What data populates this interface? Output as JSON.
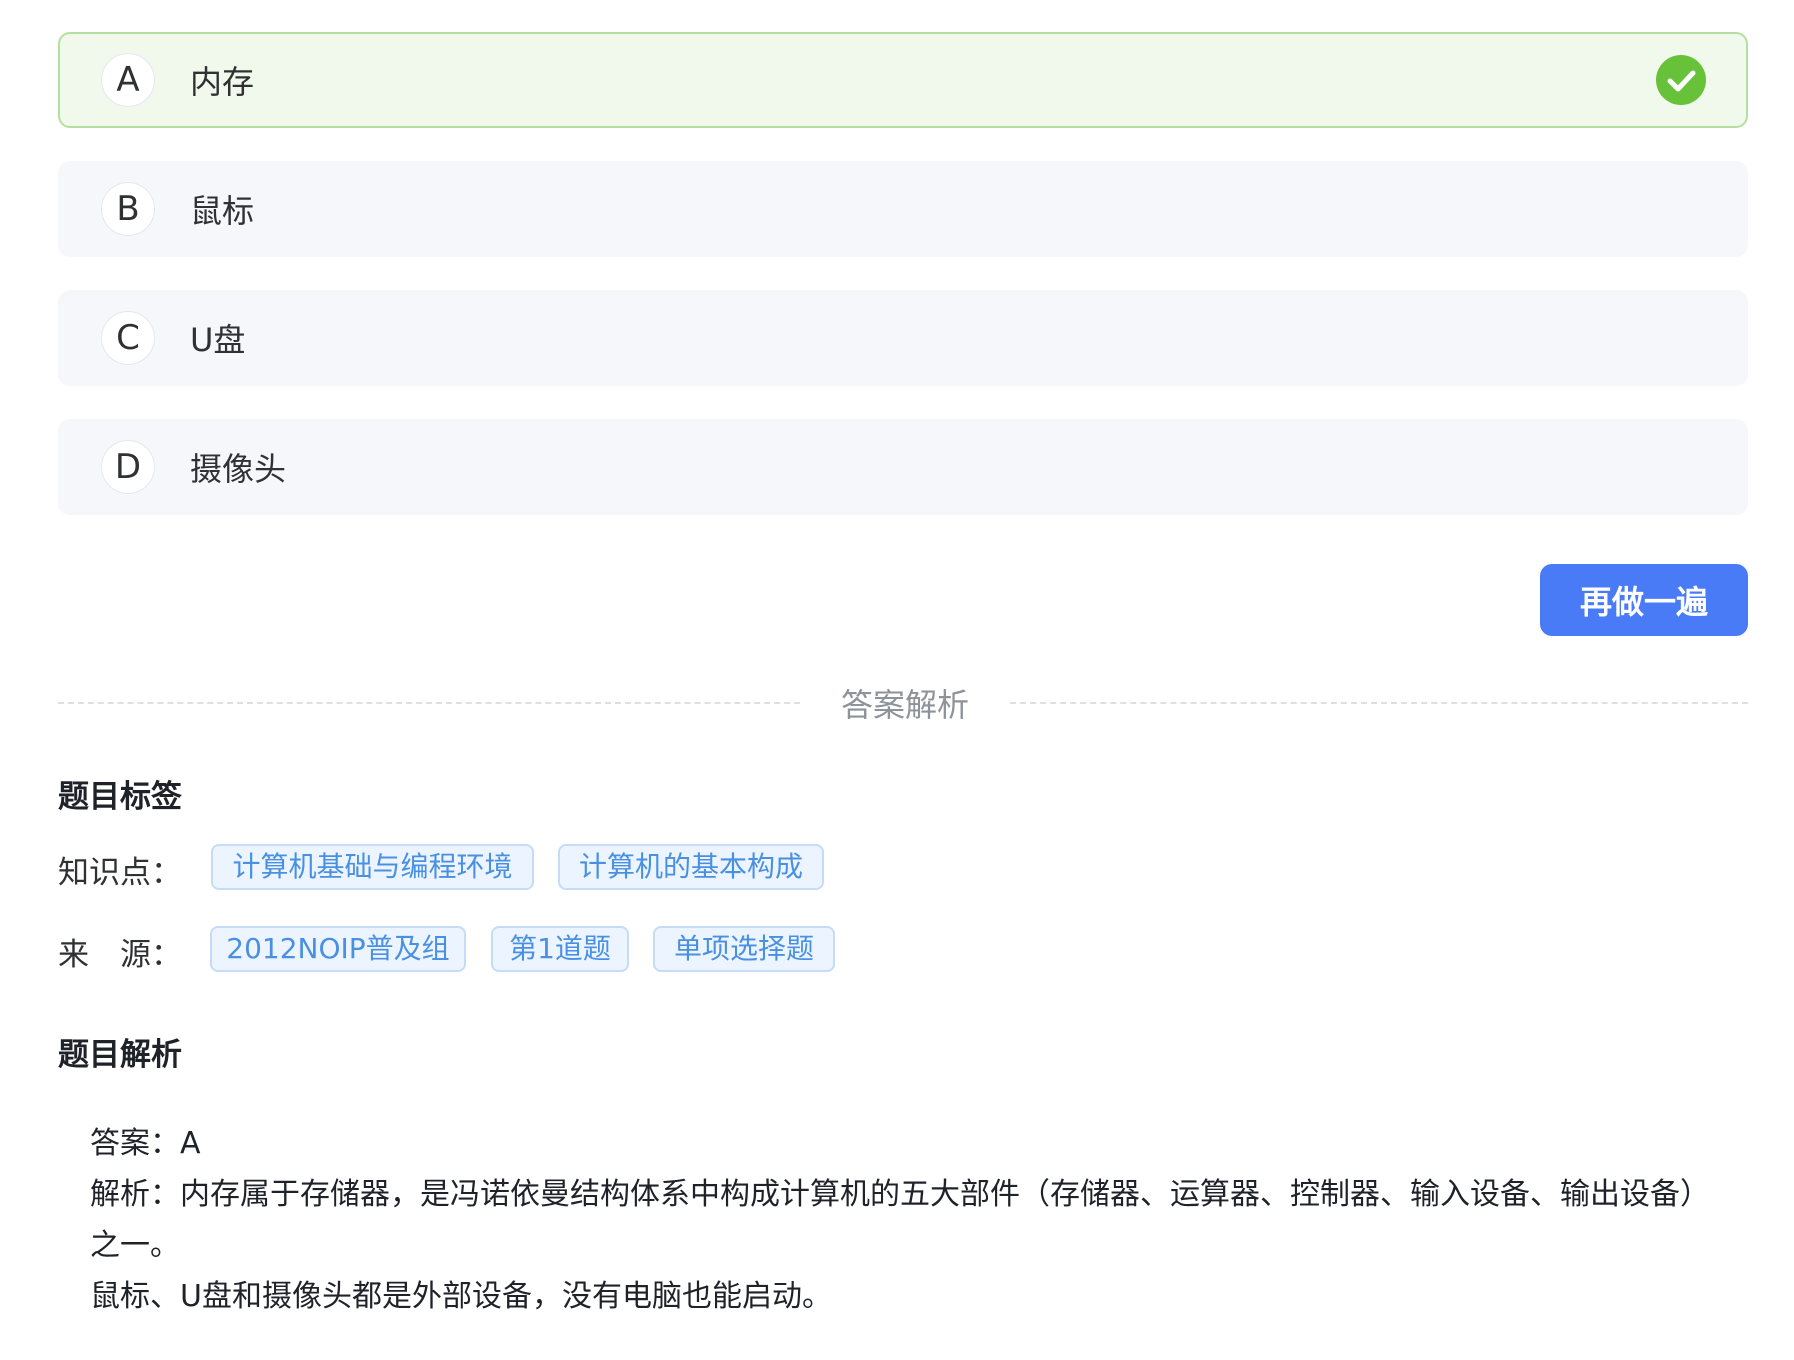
{
  "options": [
    {
      "letter": "A",
      "text": "内存",
      "correct": true
    },
    {
      "letter": "B",
      "text": "鼠标"
    },
    {
      "letter": "C",
      "text": "U盘"
    },
    {
      "letter": "D",
      "text": "摄像头"
    }
  ],
  "redo_button_label": "再做一遍",
  "divider_title": "答案解析",
  "tags_section": {
    "title": "题目标签",
    "knowledge_label": "知识点：",
    "knowledge_tags": [
      "计算机基础与编程环境",
      "计算机的基本构成"
    ],
    "source_label": "来　源：",
    "source_tags": [
      "2012NOIP普及组",
      "第1道题",
      "单项选择题"
    ]
  },
  "analysis_section": {
    "title": "题目解析",
    "answer_line": "答案：A",
    "explanation_line": "解析：内存属于存储器，是冯诺依曼结构体系中构成计算机的五大部件（存储器、运算器、控制器、输入设备、输出设备）之一。",
    "extra_line": "鼠标、U盘和摄像头都是外部设备，没有电脑也能启动。"
  },
  "colors": {
    "correct_bg": "#f0f9eb",
    "correct_border": "#b3e19d",
    "check_green": "#67c23a",
    "primary_blue": "#4a7bf7",
    "tag_blue": "#4a90e2"
  },
  "icons": {
    "correct_marker": "check-circle-icon"
  }
}
